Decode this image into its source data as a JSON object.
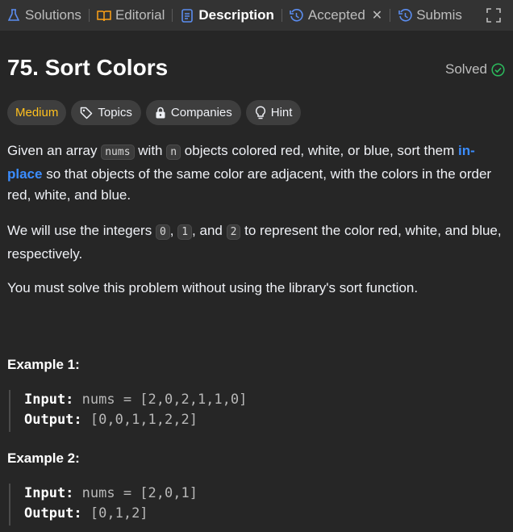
{
  "tabs": [
    {
      "label": "Solutions",
      "icon": "flask-icon"
    },
    {
      "label": "Editorial",
      "icon": "book-icon"
    },
    {
      "label": "Description",
      "icon": "document-icon",
      "active": true
    },
    {
      "label": "Accepted",
      "icon": "history-icon"
    },
    {
      "label": "Submis",
      "icon": "history-icon"
    }
  ],
  "problem": {
    "title": "75. Sort Colors",
    "status": "Solved"
  },
  "tags": {
    "difficulty": "Medium",
    "topics": "Topics",
    "companies": "Companies",
    "hint": "Hint"
  },
  "description": {
    "p1_a": "Given an array ",
    "p1_code1": "nums",
    "p1_b": " with ",
    "p1_code2": "n",
    "p1_c": " objects colored red, white, or blue, sort them ",
    "p1_link": "in-place",
    "p1_d": " so that objects of the same color are adjacent, with the colors in the order red, white, and blue.",
    "p2_a": "We will use the integers ",
    "p2_c0": "0",
    "p2_b": ", ",
    "p2_c1": "1",
    "p2_c": ", and ",
    "p2_c2": "2",
    "p2_d": " to represent the color red, white, and blue, respectively.",
    "p3": "You must solve this problem without using the library's sort function."
  },
  "examples": [
    {
      "title": "Example 1:",
      "input_label": "Input:",
      "input": " nums = [2,0,2,1,1,0]",
      "output_label": "Output:",
      "output": " [0,0,1,1,2,2]"
    },
    {
      "title": "Example 2:",
      "input_label": "Input:",
      "input": " nums = [2,0,1]",
      "output_label": "Output:",
      "output": " [0,1,2]"
    }
  ],
  "colors": {
    "background": "#262626",
    "tabbar": "#333333",
    "medium": "#ffc01e",
    "link": "#3b8dff",
    "solved_check": "#2cbb5d"
  }
}
